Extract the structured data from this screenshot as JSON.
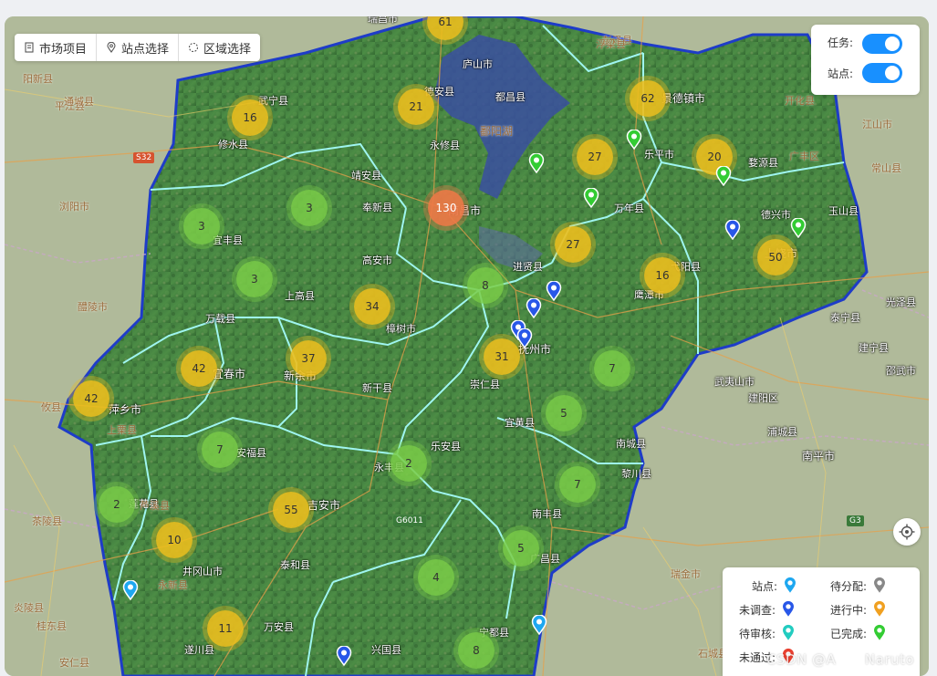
{
  "toolbar": {
    "market_label": "市场项目",
    "site_label": "站点选择",
    "region_label": "区域选择"
  },
  "toggles": {
    "task_label": "任务:",
    "task_on": true,
    "site_label": "站点:",
    "site_on": true
  },
  "legend": {
    "site": "站点:",
    "pending_assign": "待分配:",
    "not_surveyed": "未调查:",
    "in_progress": "进行中:",
    "pending_review": "待审核:",
    "completed": "已完成:",
    "not_passed": "未通过:"
  },
  "legend_colors": {
    "site": "#1ea7f0",
    "pending_assign": "#888888",
    "not_surveyed": "#2857e8",
    "in_progress": "#f0a020",
    "pending_review": "#22ccc0",
    "completed": "#33cc33",
    "not_passed": "#e84030"
  },
  "watermark": "CSDN @A      Naruto",
  "cluster_colors": {
    "green": "#7acd48",
    "yellow": "#ebbe1e",
    "orange": "#ee7846"
  },
  "clusters": [
    {
      "count": "61",
      "color": "yellow"
    },
    {
      "count": "16",
      "color": "yellow"
    },
    {
      "count": "21",
      "color": "yellow"
    },
    {
      "count": "62",
      "color": "yellow"
    },
    {
      "count": "27",
      "color": "yellow"
    },
    {
      "count": "20",
      "color": "yellow"
    },
    {
      "count": "3",
      "color": "green"
    },
    {
      "count": "130",
      "color": "orange"
    },
    {
      "count": "3",
      "color": "green"
    },
    {
      "count": "27",
      "color": "yellow"
    },
    {
      "count": "3",
      "color": "green"
    },
    {
      "count": "8",
      "color": "green"
    },
    {
      "count": "16",
      "color": "yellow"
    },
    {
      "count": "50",
      "color": "yellow"
    },
    {
      "count": "34",
      "color": "yellow"
    },
    {
      "count": "37",
      "color": "yellow"
    },
    {
      "count": "42",
      "color": "yellow"
    },
    {
      "count": "31",
      "color": "yellow"
    },
    {
      "count": "7",
      "color": "green"
    },
    {
      "count": "42",
      "color": "yellow"
    },
    {
      "count": "5",
      "color": "green"
    },
    {
      "count": "7",
      "color": "green"
    },
    {
      "count": "2",
      "color": "green"
    },
    {
      "count": "7",
      "color": "green"
    },
    {
      "count": "2",
      "color": "green"
    },
    {
      "count": "55",
      "color": "yellow"
    },
    {
      "count": "10",
      "color": "yellow"
    },
    {
      "count": "5",
      "color": "green"
    },
    {
      "count": "4",
      "color": "green"
    },
    {
      "count": "11",
      "color": "yellow"
    },
    {
      "count": "8",
      "color": "green"
    }
  ],
  "pins": [
    {
      "status": "completed"
    },
    {
      "status": "completed"
    },
    {
      "status": "completed"
    },
    {
      "status": "completed"
    },
    {
      "status": "completed"
    },
    {
      "status": "not_surveyed"
    },
    {
      "status": "not_surveyed"
    },
    {
      "status": "not_surveyed"
    },
    {
      "status": "not_surveyed"
    },
    {
      "status": "not_surveyed"
    },
    {
      "status": "site"
    },
    {
      "status": "site"
    },
    {
      "status": "not_surveyed"
    }
  ],
  "places": [
    "瑞昌市",
    "庐山市",
    "武宁县",
    "德安县",
    "都昌县",
    "景德镇市",
    "修水县",
    "永修县",
    "靖安县",
    "奉新县",
    "南昌市",
    "乐平市",
    "万年县",
    "婺源县",
    "德兴市",
    "玉山县",
    "宜丰县",
    "高安市",
    "进贤县",
    "上饶市",
    "弋阳县",
    "上高县",
    "万载县",
    "樟树市",
    "抚州市",
    "鹰潭市",
    "新余市",
    "宜春市",
    "萍乡市",
    "新干县",
    "崇仁县",
    "宜黄县",
    "乐安县",
    "南城县",
    "黎川县",
    "安福县",
    "永丰县",
    "吉安市",
    "莲花县",
    "泰和县",
    "井冈山市",
    "南丰县",
    "万安县",
    "遂川县",
    "广昌县",
    "宁都县",
    "兴国县",
    "南平市",
    "浦城县",
    "建阳区",
    "武夷山市",
    "邵武市",
    "泰宁县",
    "建宁县",
    "光泽县",
    "彭泽县",
    "鄱阳湖",
    "浮梁县",
    "开化县",
    "常山县",
    "江山市",
    "广丰区",
    "平江县",
    "浏阳市",
    "醴陵市",
    "攸县",
    "茶陵县",
    "炎陵县",
    "桂东县",
    "安仁县",
    "通城县",
    "阳新县",
    "上栗县",
    "芦溪县",
    "永新县",
    "瑞金市",
    "石城县"
  ],
  "roads": [
    "S32",
    "G6011",
    "G3"
  ]
}
